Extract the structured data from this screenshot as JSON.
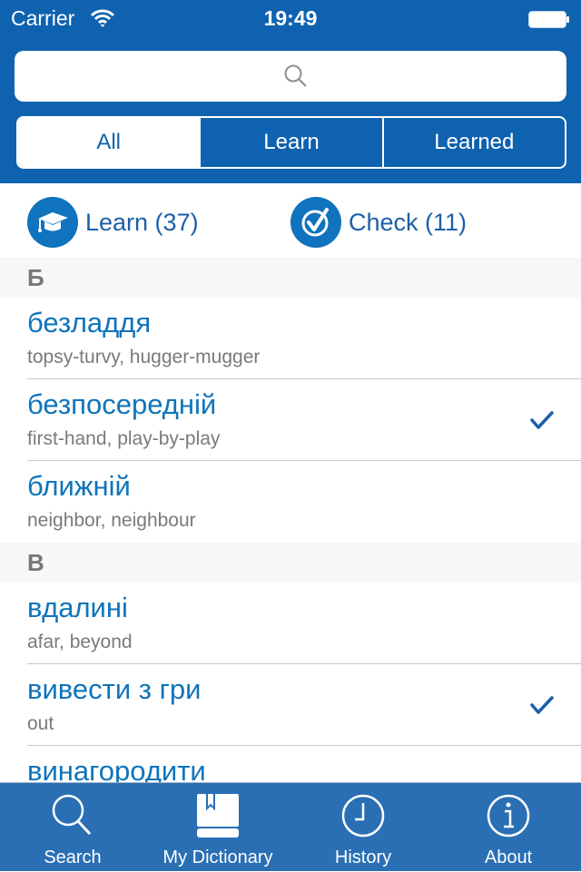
{
  "status_bar": {
    "carrier": "Carrier",
    "time": "19:49"
  },
  "search": {
    "placeholder": ""
  },
  "segments": [
    "All",
    "Learn",
    "Learned"
  ],
  "actions": {
    "learn": "Learn (37)",
    "check": "Check (11)"
  },
  "list": {
    "sections": [
      {
        "letter": "Б",
        "rows": [
          {
            "word": "безладдя",
            "translation": "topsy-turvy, hugger-mugger",
            "checked": false
          },
          {
            "word": "безпосередній",
            "translation": "first-hand, play-by-play",
            "checked": true
          },
          {
            "word": "ближній",
            "translation": "neighbor, neighbour",
            "checked": false
          }
        ]
      },
      {
        "letter": "В",
        "rows": [
          {
            "word": "вдалині",
            "translation": "afar, beyond",
            "checked": false
          },
          {
            "word": "вивести з гри",
            "translation": "out",
            "checked": true
          },
          {
            "word": "винагородити",
            "translation": "",
            "checked": false
          }
        ]
      }
    ]
  },
  "tabbar": [
    {
      "label": "Search",
      "icon": "search-icon"
    },
    {
      "label": "My Dictionary",
      "icon": "book-icon"
    },
    {
      "label": "History",
      "icon": "clock-icon"
    },
    {
      "label": "About",
      "icon": "info-icon"
    }
  ],
  "colors": {
    "brand": "#0f62b0",
    "accent": "#0f74bb",
    "tabbar": "#2a6fb4"
  }
}
